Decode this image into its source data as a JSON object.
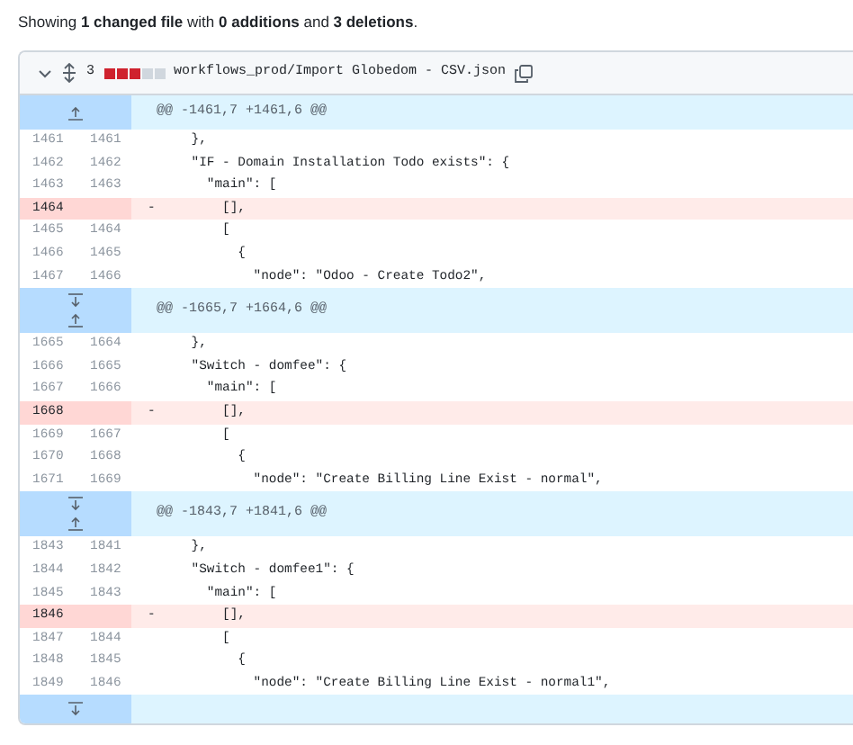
{
  "summary": "Showing **1 changed file** with **0 additions** and **3 deletions**.",
  "file": {
    "expanded": true,
    "stat": "3",
    "stat_blocks": [
      {
        "kind": "deleted"
      },
      {
        "kind": "deleted"
      },
      {
        "kind": "deleted"
      },
      {
        "kind": "neutral"
      },
      {
        "kind": "neutral"
      }
    ],
    "path": "workflows_prod/Import Globedom - CSV.json"
  },
  "hunks": [
    {
      "expand_up": true,
      "expand_down": false,
      "header": "@@ -1461,7 +1461,6 @@",
      "lines": [
        {
          "old": "1461",
          "new": "1461",
          "kind": "context",
          "code": "    },"
        },
        {
          "old": "1462",
          "new": "1462",
          "kind": "context",
          "code": "    \"IF - Domain Installation Todo exists\": {"
        },
        {
          "old": "1463",
          "new": "1463",
          "kind": "context",
          "code": "      \"main\": ["
        },
        {
          "old": "1464",
          "kind": "deleted",
          "sign": "-",
          "code": "        [],"
        },
        {
          "old": "1465",
          "new": "1464",
          "kind": "context",
          "code": "        ["
        },
        {
          "old": "1466",
          "new": "1465",
          "kind": "context",
          "code": "          {"
        },
        {
          "old": "1467",
          "new": "1466",
          "kind": "context",
          "code": "            \"node\": \"Odoo - Create Todo2\","
        }
      ]
    },
    {
      "expand_up": true,
      "expand_down": true,
      "header": "@@ -1665,7 +1664,6 @@",
      "lines": [
        {
          "old": "1665",
          "new": "1664",
          "kind": "context",
          "code": "    },"
        },
        {
          "old": "1666",
          "new": "1665",
          "kind": "context",
          "code": "    \"Switch - domfee\": {"
        },
        {
          "old": "1667",
          "new": "1666",
          "kind": "context",
          "code": "      \"main\": ["
        },
        {
          "old": "1668",
          "kind": "deleted",
          "sign": "-",
          "code": "        [],"
        },
        {
          "old": "1669",
          "new": "1667",
          "kind": "context",
          "code": "        ["
        },
        {
          "old": "1670",
          "new": "1668",
          "kind": "context",
          "code": "          {"
        },
        {
          "old": "1671",
          "new": "1669",
          "kind": "context",
          "code": "            \"node\": \"Create Billing Line Exist - normal\","
        }
      ]
    },
    {
      "expand_up": true,
      "expand_down": true,
      "header": "@@ -1843,7 +1841,6 @@",
      "lines": [
        {
          "old": "1843",
          "new": "1841",
          "kind": "context",
          "code": "    },"
        },
        {
          "old": "1844",
          "new": "1842",
          "kind": "context",
          "code": "    \"Switch - domfee1\": {"
        },
        {
          "old": "1845",
          "new": "1843",
          "kind": "context",
          "code": "      \"main\": ["
        },
        {
          "old": "1846",
          "kind": "deleted",
          "sign": "-",
          "code": "        [],"
        },
        {
          "old": "1847",
          "new": "1844",
          "kind": "context",
          "code": "        ["
        },
        {
          "old": "1848",
          "new": "1845",
          "kind": "context",
          "code": "          {"
        },
        {
          "old": "1849",
          "new": "1846",
          "kind": "context",
          "code": "            \"node\": \"Create Billing Line Exist - normal1\","
        }
      ]
    }
  ],
  "footer_expander": {
    "expand_up": false,
    "expand_down": true
  }
}
